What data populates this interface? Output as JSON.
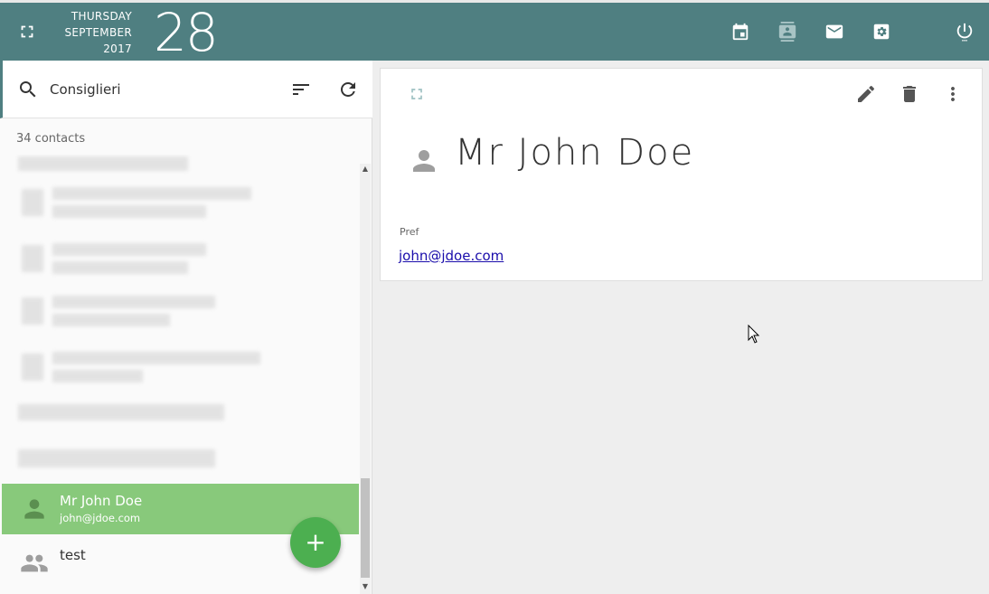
{
  "header": {
    "weekday": "THURSDAY",
    "month": "SEPTEMBER",
    "year": "2017",
    "day": "28",
    "icons": [
      "fullscreen-icon",
      "calendar-icon",
      "contacts-icon",
      "mail-icon",
      "settings-icon",
      "power-icon"
    ]
  },
  "search": {
    "value": "Consiglieri"
  },
  "contacts": {
    "count_label": "34 contacts",
    "items": [
      {
        "name": "Mr John Doe",
        "email": "john@jdoe.com",
        "selected": true
      },
      {
        "name": "test",
        "email": "",
        "selected": false
      }
    ]
  },
  "detail": {
    "full_name": "Mr John Doe",
    "email_label": "Pref",
    "email": "john@jdoe.com"
  },
  "colors": {
    "topbar": "#4f7f81",
    "selected_row": "#88c97b",
    "fab": "#4caf50",
    "link": "#1a0dab"
  },
  "fab_label": "+"
}
